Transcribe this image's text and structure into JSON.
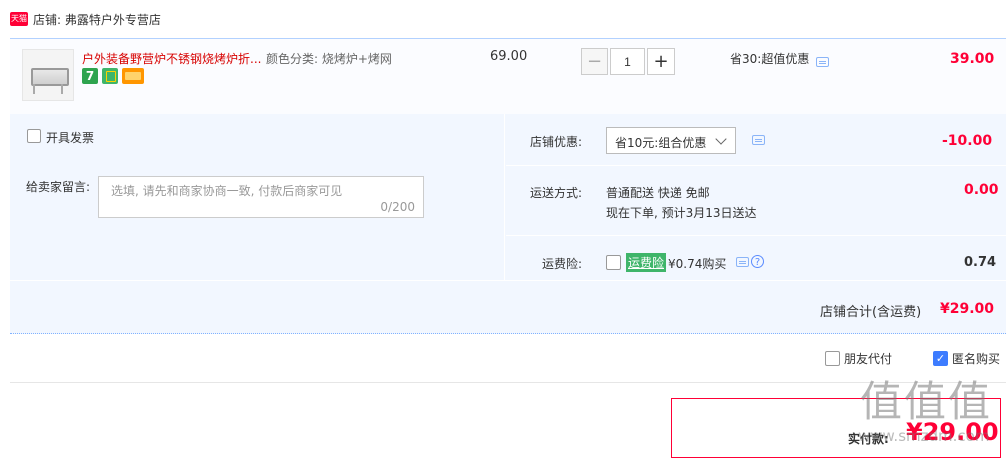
{
  "shop": {
    "badge_text": "天猫",
    "name": "店铺: 弗露特户外专营店"
  },
  "item": {
    "title": "户外装备野营炉不锈钢烧烤炉折...",
    "sku": "颜色分类: 烧烤炉+烤网",
    "badge_first": "7",
    "unit_price": "69.00",
    "quantity": "1",
    "minus": "−",
    "plus": "+",
    "promo": "省30:超值优惠",
    "subtotal": "39.00"
  },
  "invoice": {
    "label": "开具发票",
    "checked": false
  },
  "message": {
    "label": "给卖家留言:",
    "placeholder": "选填, 请先和商家协商一致, 付款后商家可见",
    "count": "0/200"
  },
  "shop_discount": {
    "label": "店铺优惠:",
    "selected": "省10元:组合优惠",
    "amount": "-10.00"
  },
  "shipping": {
    "label": "运送方式:",
    "method": "普通配送 快递 免邮",
    "eta": "现在下单, 预计3月13日送达",
    "amount": "0.00"
  },
  "insurance": {
    "label": "运费险:",
    "tag": "运费险",
    "price": "¥0.74购买",
    "help": "?",
    "amount": "0.74",
    "checked": false
  },
  "summary": {
    "label": "店铺合计(含运费)",
    "amount": "¥29.00"
  },
  "options": {
    "friend_pay": "朋友代付",
    "friend_checked": false,
    "anonymous": "匿名购买",
    "anonymous_checked": true,
    "check_mark": "✓"
  },
  "payment": {
    "label": "实付款:",
    "amount": "¥29.00"
  },
  "watermark": {
    "text": "值值值",
    "sub": "www.smzdm.com"
  },
  "colors": {
    "accent_red": "#ff0036",
    "accent_blue": "#3d7cff",
    "panel_bg": "#f2f7ff",
    "border_blue": "#b2d1ff",
    "insurance_green": "#3fb56a"
  }
}
